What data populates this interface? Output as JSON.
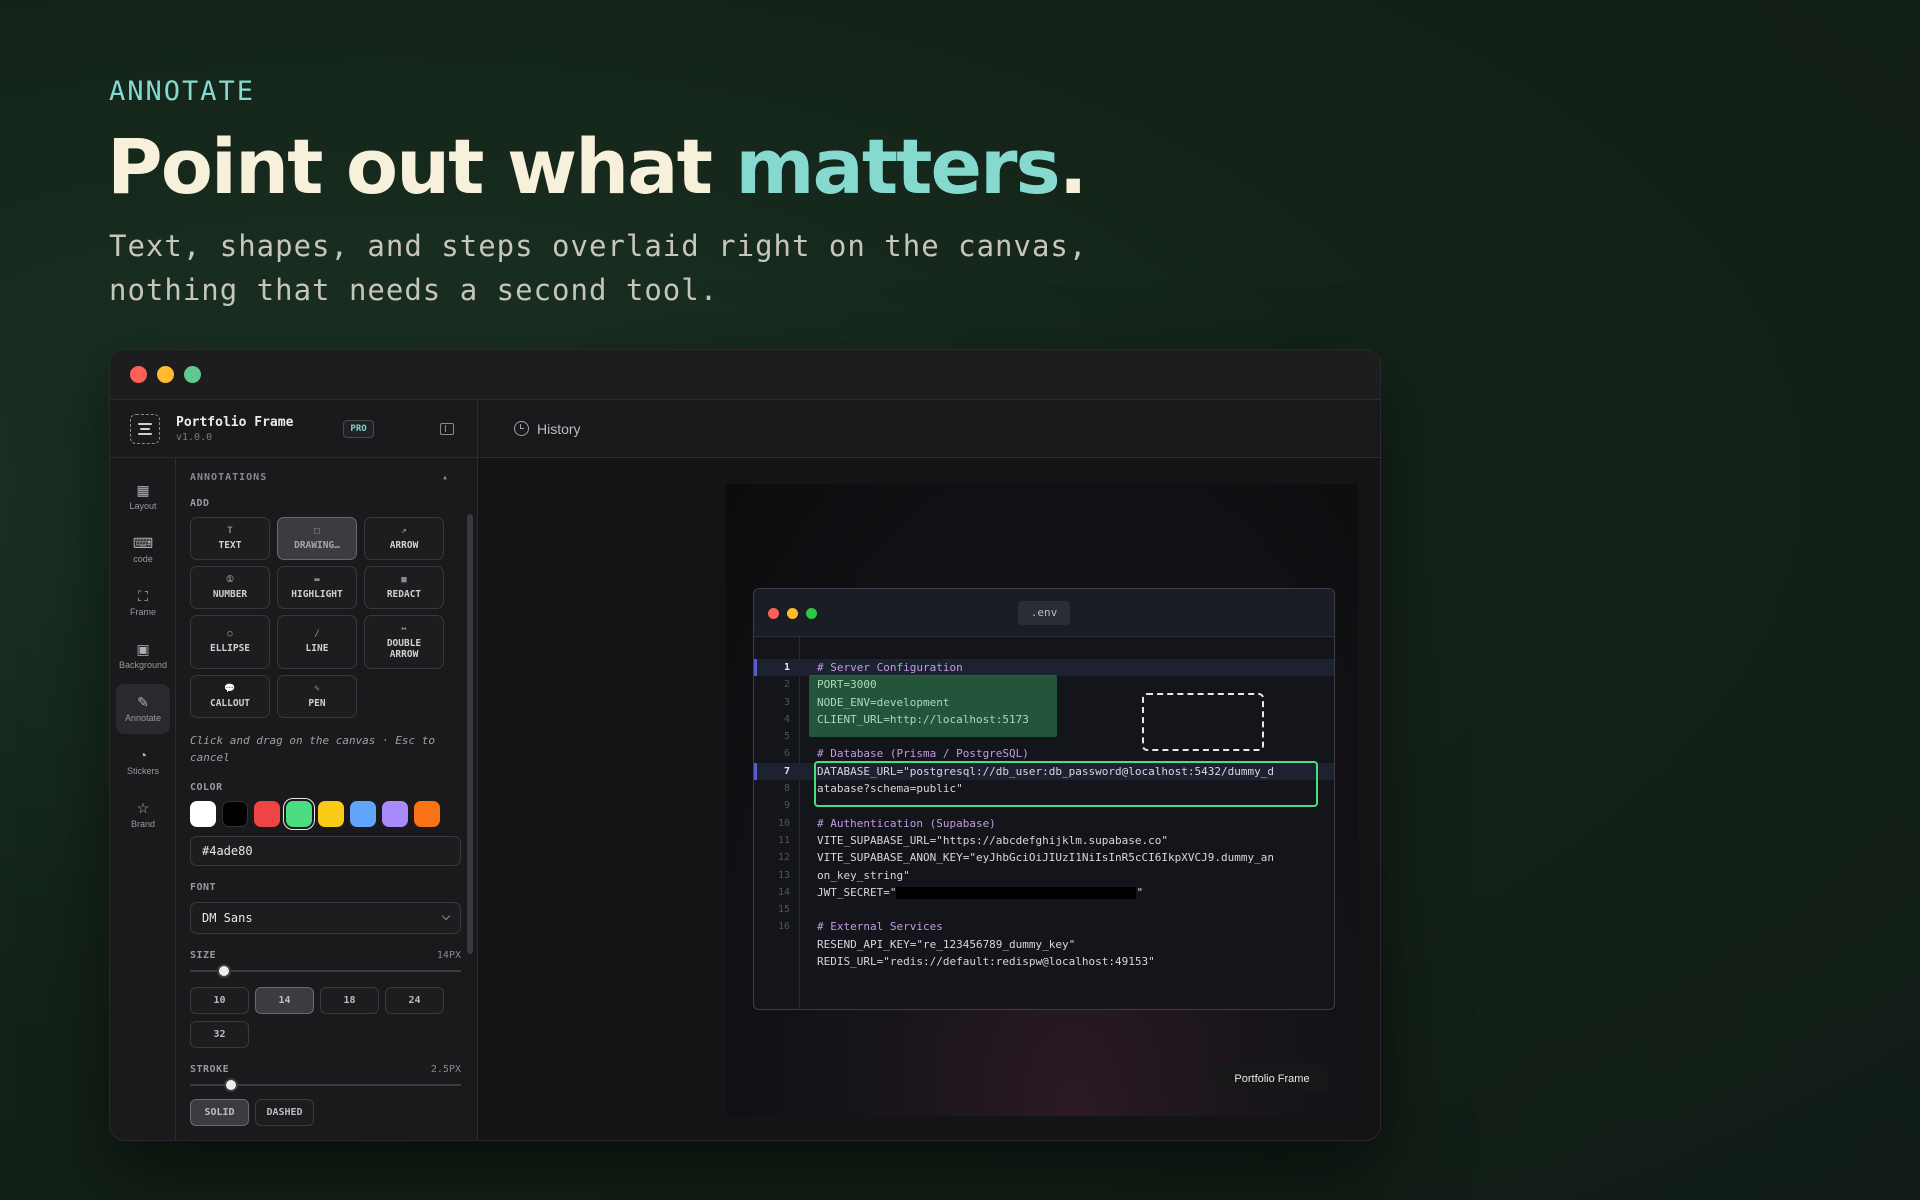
{
  "hero": {
    "eyebrow": "ANNOTATE",
    "headline_main": "Point out what ",
    "headline_accent": "matters",
    "headline_end": ".",
    "subhead_line1": "Text, shapes, and steps overlaid right on the canvas,",
    "subhead_line2": "nothing that needs a second tool."
  },
  "app": {
    "brand": {
      "name": "Portfolio Frame",
      "version": "v1.0.0",
      "badge": "PRO",
      "logo_icon": "frame-logo-icon",
      "collapse_icon": "sidebar-collapse-icon"
    },
    "rail": [
      {
        "label": "Layout",
        "icon": "layout-icon",
        "glyph": "▦"
      },
      {
        "label": "code",
        "icon": "code-icon",
        "glyph": "⌨"
      },
      {
        "label": "Frame",
        "icon": "frame-icon",
        "glyph": "⛶"
      },
      {
        "label": "Background",
        "icon": "image-icon",
        "glyph": "▣"
      },
      {
        "label": "Annotate",
        "icon": "pencil-icon",
        "glyph": "✎"
      },
      {
        "label": "Stickers",
        "icon": "sticker-icon",
        "glyph": "◔"
      },
      {
        "label": "Brand",
        "icon": "star-icon",
        "glyph": "☆"
      }
    ],
    "panel": {
      "section_title": "ANNOTATIONS",
      "section_toggle": "▴",
      "add_label": "ADD",
      "tools": [
        {
          "label": "TEXT",
          "glyph": "T"
        },
        {
          "label": "DRAWING…",
          "glyph": "□"
        },
        {
          "label": "ARROW",
          "glyph": "↗"
        },
        {
          "label": "NUMBER",
          "glyph": "①"
        },
        {
          "label": "HIGHLIGHT",
          "glyph": "▬"
        },
        {
          "label": "REDACT",
          "glyph": "■"
        },
        {
          "label": "ELLIPSE",
          "glyph": "○"
        },
        {
          "label": "LINE",
          "glyph": "/"
        },
        {
          "label": "DOUBLE\nARROW",
          "glyph": "↔"
        },
        {
          "label": "CALLOUT",
          "glyph": "💬"
        },
        {
          "label": "PEN",
          "glyph": "✎"
        }
      ],
      "hint": "Click and drag on the canvas · Esc to cancel",
      "color_label": "COLOR",
      "swatches": [
        "#ffffff",
        "#000000",
        "#ef4444",
        "#4ade80",
        "#facc15",
        "#60a5fa",
        "#a78bfa",
        "#f97316"
      ],
      "color_value": "#4ade80",
      "font_label": "FONT",
      "font_value": "DM Sans",
      "size_label": "SIZE",
      "size_value": "14PX",
      "sizes": [
        "10",
        "14",
        "18",
        "24",
        "32"
      ],
      "stroke_label": "STROKE",
      "stroke_value": "2.5PX",
      "stroke_styles": [
        "SOLID",
        "DASHED"
      ]
    },
    "topbar": {
      "history_label": "History"
    },
    "preview": {
      "file_name": ".env",
      "badge": "Portfolio Frame",
      "code_lines": [
        {
          "n": "1",
          "text": "# Server Configuration",
          "comment": true,
          "hl": true
        },
        {
          "n": "2",
          "text": "PORT=3000"
        },
        {
          "n": "3",
          "text": "NODE_ENV=development"
        },
        {
          "n": "4",
          "text": "CLIENT_URL=http://localhost:5173"
        },
        {
          "n": "5",
          "text": ""
        },
        {
          "n": "6",
          "text": "# Database (Prisma / PostgreSQL)",
          "comment": true
        },
        {
          "n": "7",
          "text": "DATABASE_URL=\"postgresql://db_user:db_password@localhost:5432/dummy_d",
          "hl": true
        },
        {
          "n": "8",
          "text": "atabase?schema=public\""
        },
        {
          "n": "9",
          "text": ""
        },
        {
          "n": "10",
          "text": "# Authentication (Supabase)",
          "comment": true
        },
        {
          "n": "11",
          "text": "VITE_SUPABASE_URL=\"https://abcdefghijklm.supabase.co\""
        },
        {
          "n": "12",
          "text": "VITE_SUPABASE_ANON_KEY=\"eyJhbGciOiJIUzI1NiIsInR5cCI6IkpXVCJ9.dummy_an"
        },
        {
          "n": "13",
          "text": "on_key_string\""
        },
        {
          "n": "14",
          "text": "JWT_SECRET=\"",
          "redacted": true,
          "after": "\""
        },
        {
          "n": "15",
          "text": ""
        },
        {
          "n": "16",
          "text": "# External Services",
          "comment": true
        },
        {
          "n": "",
          "text": "RESEND_API_KEY=\"re_123456789_dummy_key\""
        },
        {
          "n": "",
          "text": "REDIS_URL=\"redis://default:redispw@localhost:49153\""
        }
      ]
    }
  }
}
